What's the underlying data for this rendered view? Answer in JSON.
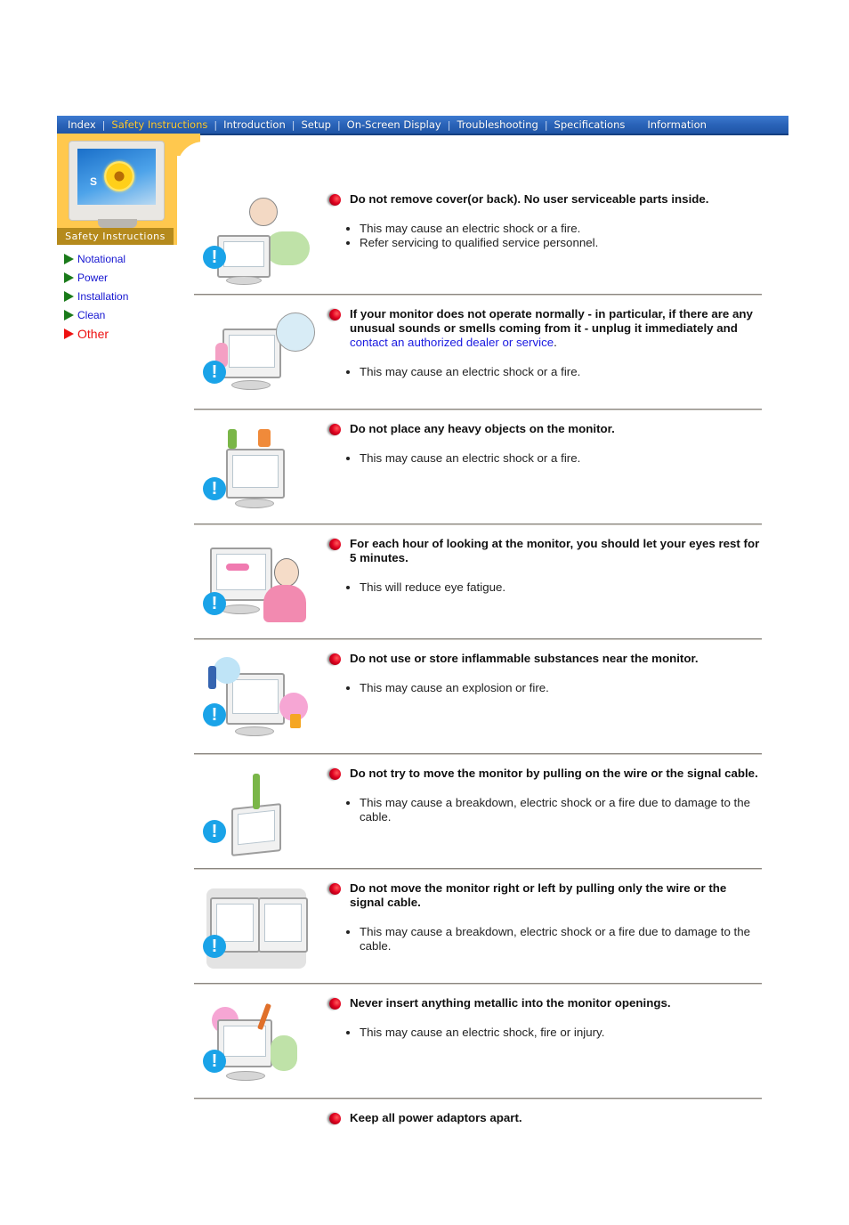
{
  "topnav": {
    "items": [
      {
        "label": "Index",
        "active": false
      },
      {
        "label": "Safety Instructions",
        "active": true
      },
      {
        "label": "Introduction",
        "active": false
      },
      {
        "label": "Setup",
        "active": false
      },
      {
        "label": "On-Screen Display",
        "active": false
      },
      {
        "label": "Troubleshooting",
        "active": false
      },
      {
        "label": "Specifications",
        "active": false
      },
      {
        "label": "Information",
        "active": false
      }
    ],
    "colors": {
      "bar": "#2a63b8",
      "text": "#ffffff",
      "active_text": "#ffcc33"
    }
  },
  "banner": {
    "title": "Safety Instructions",
    "accent_color": "#ffc84e",
    "title_bg": "#b58a1c",
    "monitor_letter": "S"
  },
  "submenu": {
    "items": [
      {
        "label": "Notational",
        "current": false
      },
      {
        "label": "Power",
        "current": false
      },
      {
        "label": "Installation",
        "current": false
      },
      {
        "label": "Clean",
        "current": false
      },
      {
        "label": "Other",
        "current": true
      }
    ],
    "colors": {
      "link": "#1515d0",
      "current": "#ee1111",
      "arrow": "#1a7a1a"
    }
  },
  "sections": [
    {
      "illustration": "technician-opening-monitor-illustration",
      "heading": "Do not remove cover(or back). No user serviceable parts inside.",
      "bullets": [
        "This may cause an electric shock or a fire.",
        "Refer servicing to qualified service personnel."
      ]
    },
    {
      "illustration": "monitor-unplug-call-service-illustration",
      "heading": "If your monitor does not operate normally - in particular, if there are any unusual sounds or smells coming from it - unplug it immediately and ",
      "link": "contact an authorized dealer or service",
      "heading_suffix": ".",
      "bullets": [
        "This may cause an electric shock or a fire."
      ]
    },
    {
      "illustration": "heavy-objects-on-monitor-illustration",
      "heading": "Do not place any heavy objects on the monitor.",
      "bullets": [
        "This may cause an electric shock or a fire."
      ]
    },
    {
      "illustration": "eye-rest-illustration",
      "heading": "For each hour of looking at the monitor, you should let your eyes rest for 5 minutes.",
      "bullets": [
        "This will reduce eye fatigue."
      ]
    },
    {
      "illustration": "inflammable-substances-illustration",
      "heading": "Do not use or store inflammable substances near the monitor.",
      "bullets": [
        "This may cause an explosion or fire."
      ]
    },
    {
      "illustration": "pulling-wire-illustration",
      "heading": "Do not try to move the monitor by pulling on the wire or the signal cable.",
      "bullets": [
        "This may cause a breakdown, electric shock or a fire due to damage to the cable."
      ]
    },
    {
      "illustration": "moving-monitor-left-right-illustration",
      "heading": "Do not move the monitor right or left by pulling only the wire or the signal cable.",
      "bullets": [
        "This may cause a breakdown, electric shock or a fire due to damage to the cable."
      ]
    },
    {
      "illustration": "metallic-object-insertion-illustration",
      "heading": "Never insert anything metallic into the monitor openings.",
      "bullets": [
        "This may cause an electric shock, fire or injury."
      ]
    },
    {
      "illustration": "",
      "heading": "Keep all power adaptors apart.",
      "bullets": []
    }
  ],
  "icons": {
    "warning": "exclamation-circle",
    "heading_bullet": "red-ball",
    "submenu_arrow": "triangle-right"
  }
}
